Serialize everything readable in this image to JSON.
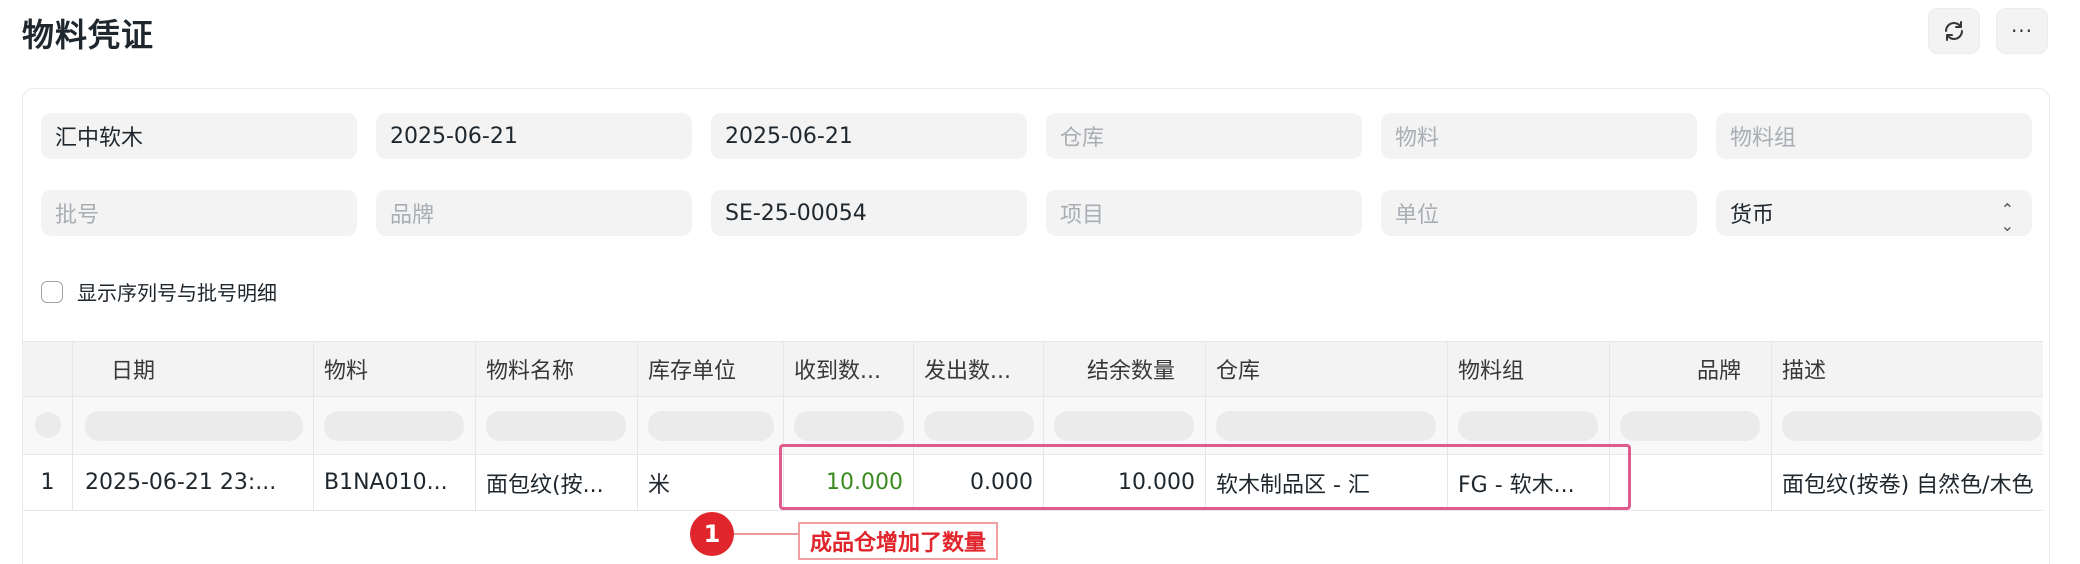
{
  "page": {
    "title": "物料凭证"
  },
  "toolbar": {
    "refresh_icon": "refresh-icon",
    "more_label": "···"
  },
  "filters": {
    "company": "汇中软木",
    "from_date": "2025-06-21",
    "to_date": "2025-06-21",
    "warehouse_placeholder": "仓库",
    "item_placeholder": "物料",
    "item_group_placeholder": "物料组",
    "batch_placeholder": "批号",
    "brand_placeholder": "品牌",
    "voucher_no": "SE-25-00054",
    "project_placeholder": "项目",
    "uom_placeholder": "单位",
    "currency": "货币"
  },
  "options": {
    "show_serial_batch_label": "显示序列号与批号明细"
  },
  "table": {
    "columns": [
      "日期",
      "物料",
      "物料名称",
      "库存单位",
      "收到数...",
      "发出数...",
      "结余数量",
      "仓库",
      "物料组",
      "品牌",
      "描述"
    ],
    "rows": [
      {
        "index": "1",
        "date": "2025-06-21 23:...",
        "item": "B1NA010...",
        "item_name": "面包纹(按...",
        "uom": "米",
        "in_qty": "10.000",
        "out_qty": "0.000",
        "balance_qty": "10.000",
        "warehouse": "软木制品区 - 汇",
        "item_group": "FG - 软木...",
        "brand": "",
        "description": "面包纹(按卷) 自然色/木色"
      }
    ]
  },
  "annotation": {
    "number": "1",
    "label": "成品仓增加了数量",
    "color": "#e0262c"
  }
}
